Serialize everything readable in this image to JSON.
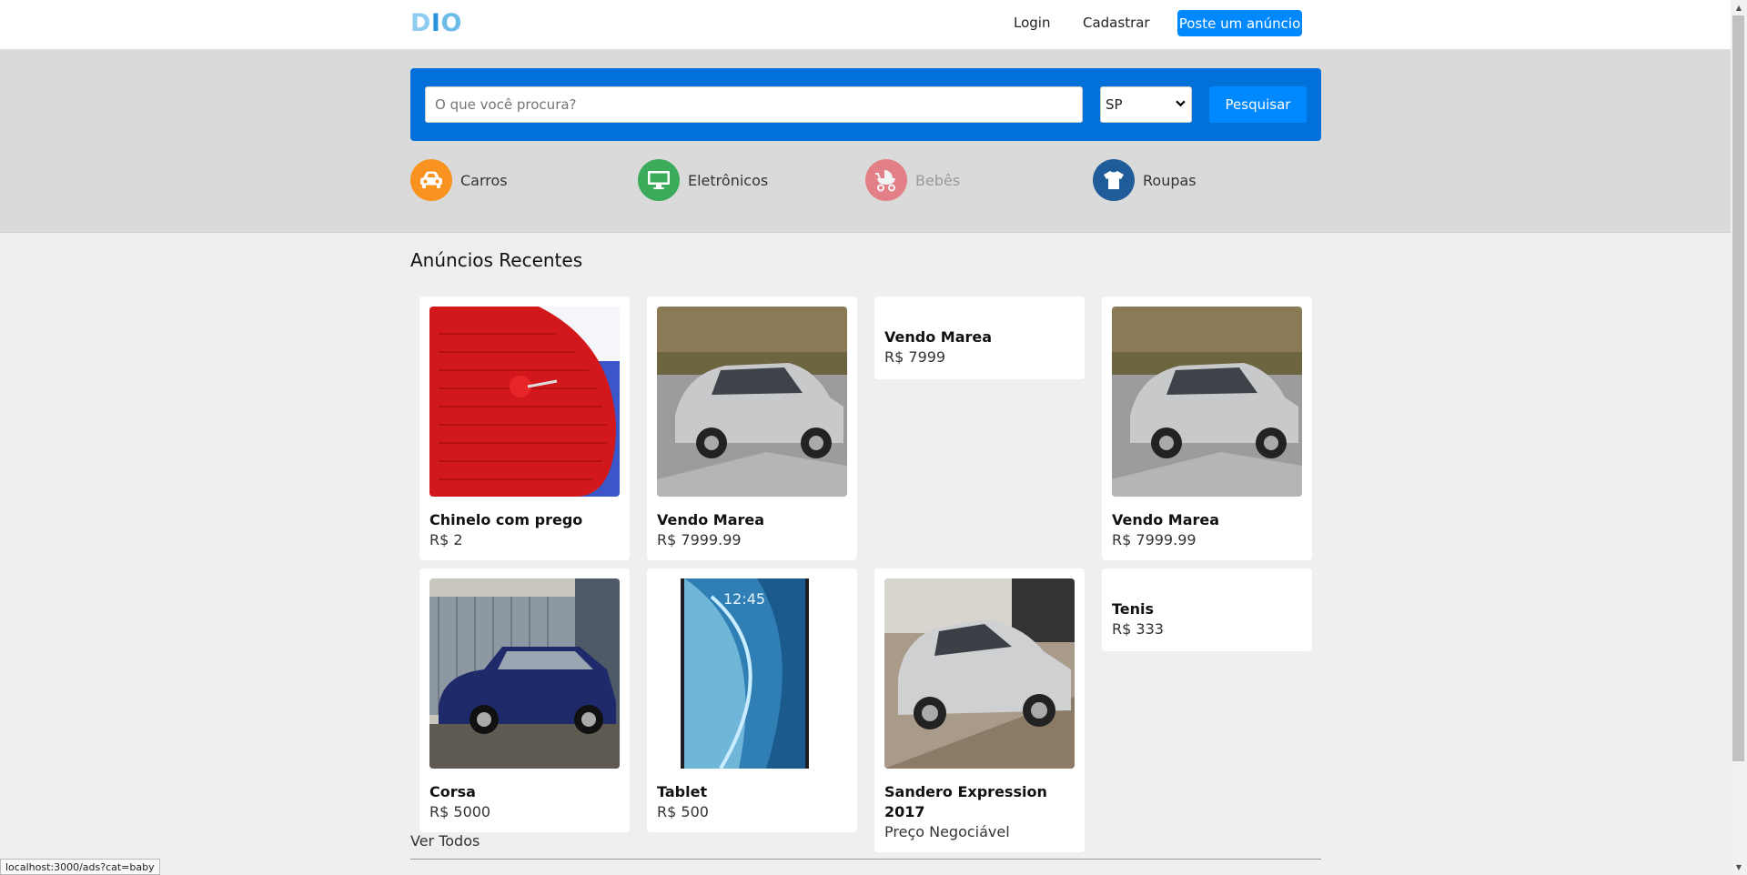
{
  "header": {
    "logo": [
      "D",
      "I",
      "O"
    ],
    "login": "Login",
    "signup": "Cadastrar",
    "post_ad": "Poste um anúncio"
  },
  "search": {
    "placeholder": "O que você procura?",
    "state": "SP",
    "button": "Pesquisar"
  },
  "categories": [
    {
      "label": "Carros",
      "icon": "car-icon",
      "color": "#f7931e"
    },
    {
      "label": "Eletrônicos",
      "icon": "monitor-icon",
      "color": "#3aab58"
    },
    {
      "label": "Bebês",
      "icon": "stroller-icon",
      "color": "#e8505b"
    },
    {
      "label": "Roupas",
      "icon": "shirt-icon",
      "color": "#1f5c99"
    }
  ],
  "recent": {
    "title": "Anúncios Recentes",
    "items": [
      {
        "title": "Chinelo com prego",
        "price": "R$ 2",
        "image": "red-slipper-with-nail"
      },
      {
        "title": "Vendo Marea",
        "price": "R$ 7999.99",
        "image": "silver-sedan"
      },
      {
        "title": "Vendo Marea",
        "price": "R$ 7999"
      },
      {
        "title": "Vendo Marea",
        "price": "R$ 7999.99",
        "image": "silver-sedan"
      },
      {
        "title": "Corsa",
        "price": "R$ 5000",
        "image": "blue-sedan"
      },
      {
        "title": "Tablet",
        "price": "R$ 500",
        "image": "tablet"
      },
      {
        "title": "Sandero Expression 2017",
        "price": "Preço Negociável",
        "image": "silver-hatchback"
      },
      {
        "title": "Tenis",
        "price": "R$ 333"
      }
    ],
    "see_all": "Ver Todos"
  },
  "statusbar": "localhost:3000/ads?cat=baby",
  "colors": {
    "primary": "#0089ff",
    "search_bg": "#0071d9"
  }
}
